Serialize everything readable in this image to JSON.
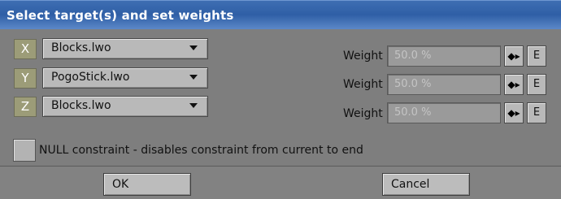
{
  "window": {
    "title": "Select target(s) and set weights"
  },
  "targets": [
    {
      "axis": "X",
      "object": "Blocks.lwo",
      "weight_label": "Weight",
      "weight_value": "50.0 %",
      "envelope_label": "E",
      "spin_glyph": "◆▸"
    },
    {
      "axis": "Y",
      "object": "PogoStick.lwo",
      "weight_label": "Weight",
      "weight_value": "50.0 %",
      "envelope_label": "E",
      "spin_glyph": "◆▸"
    },
    {
      "axis": "Z",
      "object": "Blocks.lwo",
      "weight_label": "Weight",
      "weight_value": "50.0 %",
      "envelope_label": "E",
      "spin_glyph": "◆▸"
    }
  ],
  "null_constraint": {
    "label": "NULL constraint - disables constraint from current to end",
    "checked": false
  },
  "buttons": {
    "ok": "OK",
    "cancel": "Cancel"
  },
  "colors": {
    "titlebar": "#2f5fa6",
    "panel": "#7e7e7e",
    "axis_badge": "#9c9c78",
    "field": "#9a9a9a"
  }
}
